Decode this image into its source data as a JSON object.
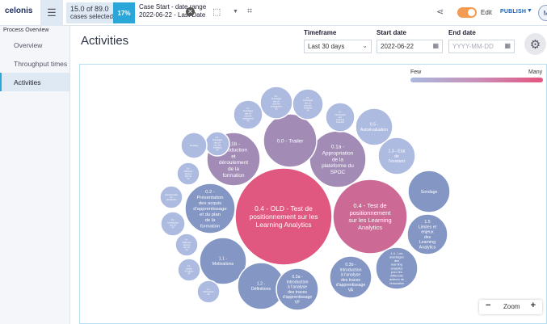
{
  "topbar": {
    "logo_text": "celonis",
    "cases_selected_count": "15.0 of 89.0",
    "cases_selected_label": "cases selected",
    "percentage": "17%",
    "filter_title": "Case Start - date range",
    "filter_value": "2022-06-22 - Last Date",
    "edit_label": "Edit",
    "publish_label": "PUBLISH",
    "avatar_initial": "M"
  },
  "sidebar": {
    "heading": "Process Overview",
    "items": [
      {
        "label": "Overview"
      },
      {
        "label": "Throughput times"
      },
      {
        "label": "Activities"
      }
    ]
  },
  "page": {
    "title": "Activities"
  },
  "filters": {
    "timeframe": {
      "label": "Timeframe",
      "value": "Last 30 days"
    },
    "start_date": {
      "label": "Start date",
      "value": "2022-06-22"
    },
    "end_date": {
      "label": "End date",
      "placeholder": "YYYY-MM-DD"
    }
  },
  "legend": {
    "few": "Few",
    "many": "Many",
    "color_low": "#a9b8df",
    "color_high": "#e3557f"
  },
  "zoom": {
    "label": "Zoom",
    "minus": "−",
    "plus": "+"
  },
  "bubbles": [
    {
      "lines": [
        "0.4 - OLD - Test de",
        "positionnement sur les",
        "Learning Analytics"
      ],
      "color": "#e0577f",
      "weight": 1.0
    },
    {
      "lines": [
        "0.4 - Test de",
        "positionnement",
        "sur les Learning",
        "Analytics"
      ],
      "color": "#cc6a95",
      "weight": 0.8
    },
    {
      "lines": [
        "0.1a -",
        "Appropriation",
        "de la",
        "plateforme du",
        "SPOC"
      ],
      "color": "#a28cb6",
      "weight": 0.55
    },
    {
      "lines": [
        "0.0 - Trailer"
      ],
      "color": "#a28cb6",
      "weight": 0.55
    },
    {
      "lines": [
        "0.1b -",
        "Introduction",
        "et",
        "déroulement",
        "de la",
        "formation"
      ],
      "color": "#a28cb6",
      "weight": 0.5
    },
    {
      "lines": [
        "1.3 - Etat",
        "de",
        "l'existant"
      ],
      "color": "#aebbe0",
      "weight": 0.3
    },
    {
      "lines": [
        "Sondage"
      ],
      "color": "#8396c4",
      "weight": 0.4
    },
    {
      "lines": [
        "1.1 -",
        "Motivations"
      ],
      "color": "#8396c4",
      "weight": 0.4
    },
    {
      "lines": [
        "1.2 -",
        "Définitions"
      ],
      "color": "#8396c4",
      "weight": 0.4
    },
    {
      "lines": [
        "0.2 -",
        "Présentation",
        "des acquis",
        "d'apprentissage",
        "et du plan",
        "de la",
        "formation"
      ],
      "color": "#8396c4",
      "weight": 0.4
    },
    {
      "lines": [
        "0.3a -",
        "Introduction",
        "à l'analyse",
        "des traces",
        "d'apprentissage",
        "VF"
      ],
      "color": "#8396c4",
      "weight": 0.4
    },
    {
      "lines": [
        "0.3b -",
        "Introduction",
        "à l'analyse",
        "des traces",
        "d'apprentissage",
        "VA"
      ],
      "color": "#8396c4",
      "weight": 0.4
    },
    {
      "lines": [
        "1.5",
        "Limites et",
        "enjeux",
        "des",
        "Learning",
        "Analytics"
      ],
      "color": "#8396c4",
      "weight": 0.35
    },
    {
      "lines": [
        "1.4 - Les",
        "avantages",
        "des",
        "learning",
        "analytics",
        "pour les",
        "différents",
        "acteurs de",
        "l'éducation"
      ],
      "color": "#8396c4",
      "weight": 0.35
    },
    {
      "lines": [
        "0.5 -",
        "Autoévaluation"
      ],
      "color": "#aebbe0",
      "weight": 0.2
    },
    {
      "lines": [
        "1.6 -",
        "Avantages",
        "des LA",
        "pour les",
        "enseignants",
        "VA"
      ],
      "color": "#aebbe0",
      "weight": 0.15
    },
    {
      "lines": [
        "1.6 -",
        "Avantages",
        "des LA",
        "pour les",
        "étudiants",
        "VA"
      ],
      "color": "#aebbe0",
      "weight": 0.15
    },
    {
      "lines": [
        "1.4 -",
        "Avantages",
        "des LA",
        "pour les",
        "enseignants",
        "VA"
      ],
      "color": "#aebbe0",
      "weight": 0.15
    },
    {
      "lines": [
        "1.6 -",
        "Introduction",
        "aux",
        "Learning",
        "Analytics"
      ],
      "color": "#aebbe0",
      "weight": 0.15
    },
    {
      "lines": [
        "1.4 -",
        "Avantages",
        "des LA",
        "pour les",
        "étudiants",
        "VF"
      ],
      "color": "#aebbe0",
      "weight": 0.15
    },
    {
      "lines": [
        "Sondage"
      ],
      "color": "#aebbe0",
      "weight": 0.15
    },
    {
      "lines": [
        "1.6 -",
        "Différents",
        "acteurs",
        "des LA",
        "VF"
      ],
      "color": "#aebbe0",
      "weight": 0.12
    },
    {
      "lines": [
        "Questionnaire",
        "de",
        "satisfaction"
      ],
      "color": "#aebbe0",
      "weight": 0.12
    },
    {
      "lines": [
        "1.6 -",
        "Introduction",
        "aux LA",
        "VF"
      ],
      "color": "#aebbe0",
      "weight": 0.12
    },
    {
      "lines": [
        "1.4 -",
        "Différents",
        "acteurs",
        "des LA",
        "VA"
      ],
      "color": "#aebbe0",
      "weight": 0.12
    },
    {
      "lines": [
        "1.5 -",
        "Limites",
        "et enjeux",
        "VF"
      ],
      "color": "#aebbe0",
      "weight": 0.12
    },
    {
      "lines": [
        "1.1 -",
        "Motivations",
        "VA"
      ],
      "color": "#aebbe0",
      "weight": 0.12
    },
    {
      "lines": [
        "Questionnaire",
        "de",
        "satisfaction",
        "VF"
      ],
      "color": "#aebbe0",
      "weight": 0.12
    }
  ]
}
